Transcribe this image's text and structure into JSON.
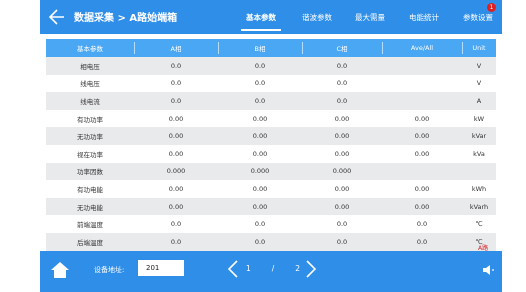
{
  "header": {
    "title": "数据采集 > A路始端箱",
    "tabs": [
      {
        "label": "基本参数",
        "active": true
      },
      {
        "label": "谐波参数",
        "active": false
      },
      {
        "label": "最大需量",
        "active": false
      },
      {
        "label": "电能统计",
        "active": false
      },
      {
        "label": "参数设置",
        "active": false
      }
    ],
    "badge_count": "1"
  },
  "table": {
    "columns": [
      "基本参数",
      "A相",
      "B相",
      "C相",
      "Ave/All",
      "Unit"
    ],
    "rows": [
      [
        "相电压",
        "0.0",
        "0.0",
        "0.0",
        "",
        "V"
      ],
      [
        "线电压",
        "0.0",
        "0.0",
        "0.0",
        "",
        "V"
      ],
      [
        "线电流",
        "0.0",
        "0.0",
        "0.0",
        "",
        "A"
      ],
      [
        "有功功率",
        "0.00",
        "0.00",
        "0.00",
        "0.00",
        "kW"
      ],
      [
        "无功功率",
        "0.00",
        "0.00",
        "0.00",
        "0.00",
        "kVar"
      ],
      [
        "视在功率",
        "0.00",
        "0.00",
        "0.00",
        "0.00",
        "kVa"
      ],
      [
        "功率因数",
        "0.000",
        "0.000",
        "0.000",
        "",
        ""
      ],
      [
        "有功电能",
        "0.00",
        "0.00",
        "0.00",
        "0.00",
        "kWh"
      ],
      [
        "无功电能",
        "0.00",
        "0.00",
        "0.00",
        "0.00",
        "kVarh"
      ],
      [
        "前端温度",
        "0.0",
        "0.0",
        "0.0",
        "0.0",
        "℃"
      ],
      [
        "后端温度",
        "0.0",
        "0.0",
        "0.0",
        "0.0",
        "℃"
      ]
    ]
  },
  "phase_tag": "A路",
  "footer": {
    "address_label": "设备地址:",
    "address_value": "201",
    "page_current": "1",
    "page_separator": "/",
    "page_total": "2"
  },
  "colors": {
    "bar": "#2f8ee8",
    "table_header": "#4aa7f4",
    "alt_row": "#e9eaec",
    "badge": "#e02020"
  },
  "icons": [
    "back-arrow-icon",
    "home-icon",
    "prev-page-icon",
    "next-page-icon",
    "speaker-icon"
  ]
}
